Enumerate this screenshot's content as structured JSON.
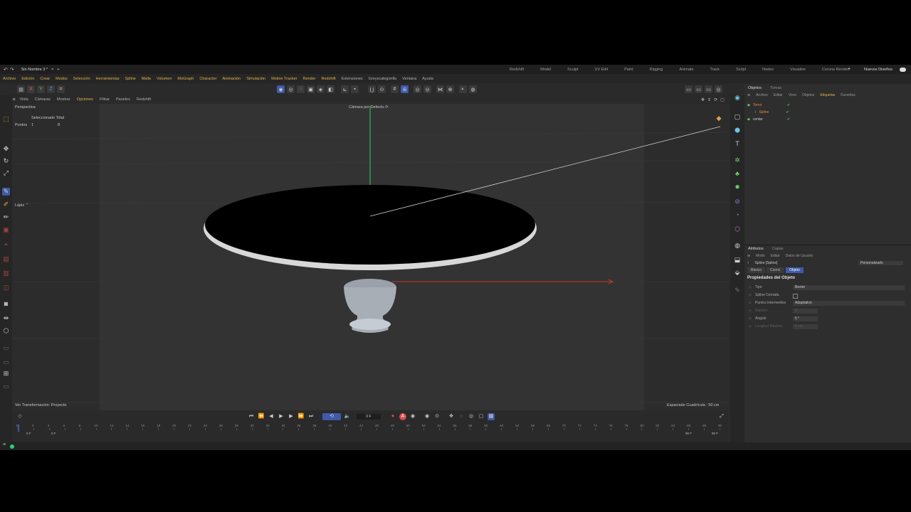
{
  "window": {
    "doc_title": "Sin Nombre 3 *",
    "layouts": [
      "Redshift",
      "Model",
      "Sculpt",
      "UV Edit",
      "Paint",
      "Rigging",
      "Animate",
      "Track",
      "Script",
      "Nodes",
      "Visualize",
      "Corona Render"
    ],
    "new_layouts": "Nuevos Diseños"
  },
  "menu": [
    "Archivo",
    "Edición",
    "Crear",
    "Modos",
    "Selección",
    "Herramientas",
    "Spline",
    "Malla",
    "Volumen",
    "MoGraph",
    "Character",
    "Animación",
    "Simulación",
    "Motion Tracker",
    "Render",
    "Redshift",
    "Extensiones",
    "Greyscalegorilla",
    "Ventana",
    "Ayuda"
  ],
  "toolbar": {
    "axes": [
      "X",
      "Y",
      "Z"
    ]
  },
  "viewport_menu": [
    "Vista",
    "Cámaras",
    "Mostrar",
    "Opciones",
    "Filtrar",
    "Paneles",
    "Redshift"
  ],
  "viewport": {
    "projection": "Perspectiva",
    "camera": "Cámara por Defecto ⟳",
    "hud_title": "Seleccionado Total",
    "hud_points_label": "Puntos",
    "hud_points_selected": "1",
    "hud_points_total": "8",
    "tool": "Lápiz ⌃",
    "transform_info": "Ver Transformación: Proyecto",
    "grid_info": "Espaciado Cuadrícula : 50 cm"
  },
  "objects_panel": {
    "tabs": [
      "Objetos",
      "Tomas"
    ],
    "menu": [
      "Archivo",
      "Editar",
      "Visor",
      "Objetos",
      "Etiquetas",
      "Favoritos"
    ],
    "items": [
      {
        "name": "Torno",
        "color": "#e6893c"
      },
      {
        "name": "Spline",
        "color": "#e6893c"
      },
      {
        "name": "centar",
        "color": "#cfcfcf"
      }
    ]
  },
  "attributes_panel": {
    "tabs": [
      "Atributos",
      "Capas"
    ],
    "menu": [
      "Modo",
      "Editar",
      "Datos de Usuario"
    ],
    "object": "Spline [Spline]",
    "preset": "Personalizado",
    "subtabs": [
      "Básico",
      "Coord.",
      "Objeto"
    ],
    "section": "Propiedades del Objeto",
    "fields": [
      {
        "label": "Tipo",
        "value": "Bezier"
      },
      {
        "label": "Spline Cerrada",
        "value": ""
      },
      {
        "label": "Puntos Intermedios",
        "value": "Adaptativo"
      },
      {
        "label": "Número",
        "value": "8"
      },
      {
        "label": "Ángulo",
        "value": "5 °"
      },
      {
        "label": "Longitud Máxima",
        "value": "5 cm"
      }
    ]
  },
  "timeline": {
    "current_frame": "0 F",
    "start": "0 F",
    "start2": "0 F",
    "end": "90 F",
    "end2": "90 F",
    "ticks": [
      "0",
      "2",
      "4",
      "6",
      "8",
      "10",
      "12",
      "14",
      "16",
      "18",
      "20",
      "22",
      "24",
      "26",
      "28",
      "30",
      "32",
      "34",
      "36",
      "38",
      "40",
      "42",
      "44",
      "46",
      "48",
      "50",
      "52",
      "54",
      "56",
      "58",
      "60",
      "62",
      "64",
      "66",
      "68",
      "70",
      "72",
      "74",
      "76",
      "78",
      "80",
      "82",
      "84",
      "86",
      "88",
      "90"
    ]
  },
  "colors": {
    "x_axis": "#c0392b",
    "y_axis": "#2ecc71",
    "accent": "#3f5aa8",
    "record": "#d84a4a"
  }
}
